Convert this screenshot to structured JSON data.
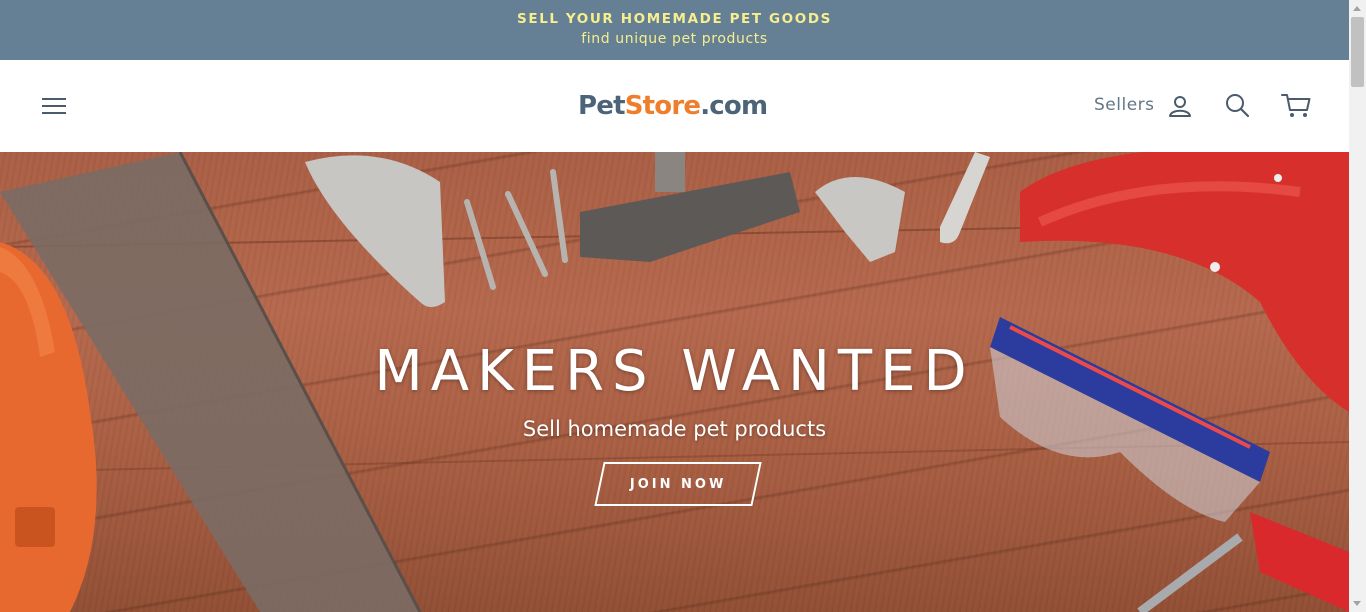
{
  "announcement": {
    "line1": "SELL YOUR HOMEMADE PET GOODS",
    "line2": "find unique pet products"
  },
  "header": {
    "logo": {
      "part1": "Pet",
      "part2": "Store",
      "part3": ".com"
    },
    "sellers_label": "Sellers",
    "icons": [
      "menu-icon",
      "user-icon",
      "search-icon",
      "cart-icon"
    ]
  },
  "hero": {
    "title": "MAKERS WANTED",
    "subtitle": "Sell homemade pet products",
    "cta_label": "JOIN NOW"
  },
  "colors": {
    "announcement_bg": "#657f95",
    "announcement_text": "#f6ef8e",
    "logo_primary": "#4d6478",
    "logo_accent": "#ef7e2c",
    "header_icons": "#4c5b6b"
  }
}
